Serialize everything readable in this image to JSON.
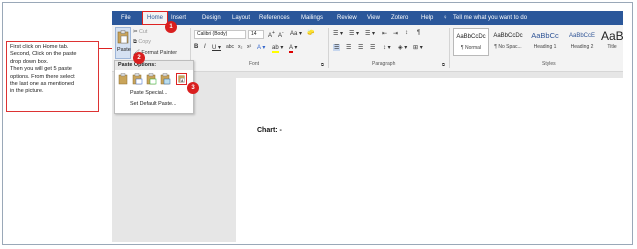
{
  "instructions": {
    "lines": [
      "First click on Home tab.",
      "Second, Click on the paste",
      "drop down box.",
      "Then you will get 5 paste",
      "options. From there select",
      "the last one as mentioned",
      "in the picture."
    ]
  },
  "tabs": [
    "File",
    "Home",
    "Insert",
    "Design",
    "Layout",
    "References",
    "Mailings",
    "Review",
    "View",
    "Zotero",
    "Help"
  ],
  "tell_me": "Tell me what you want to do",
  "clipboard": {
    "paste": "Paste",
    "cut": "Cut",
    "copy": "Copy",
    "format_painter": "Format Painter"
  },
  "font": {
    "name": "Calibri (Body)",
    "size": "14",
    "group": "Font"
  },
  "paragraph": {
    "group": "Paragraph"
  },
  "styles": {
    "group": "Styles",
    "items": [
      {
        "sample": "AaBbCcDc",
        "name": "¶ Normal"
      },
      {
        "sample": "AaBbCcDc",
        "name": "¶ No Spac..."
      },
      {
        "sample": "AaBbCc",
        "name": "Heading 1"
      },
      {
        "sample": "AaBbCcE",
        "name": "Heading 2"
      },
      {
        "sample": "AaB",
        "name": "Title"
      }
    ]
  },
  "dropdown": {
    "header": "Paste Options:",
    "paste_special": "Paste Special...",
    "set_default": "Set Default Paste..."
  },
  "document": {
    "text": "Chart: -"
  },
  "badges": [
    "1",
    "2",
    "3"
  ],
  "colors": {
    "ribbon": "#2b579a",
    "highlight": "#d22222"
  }
}
